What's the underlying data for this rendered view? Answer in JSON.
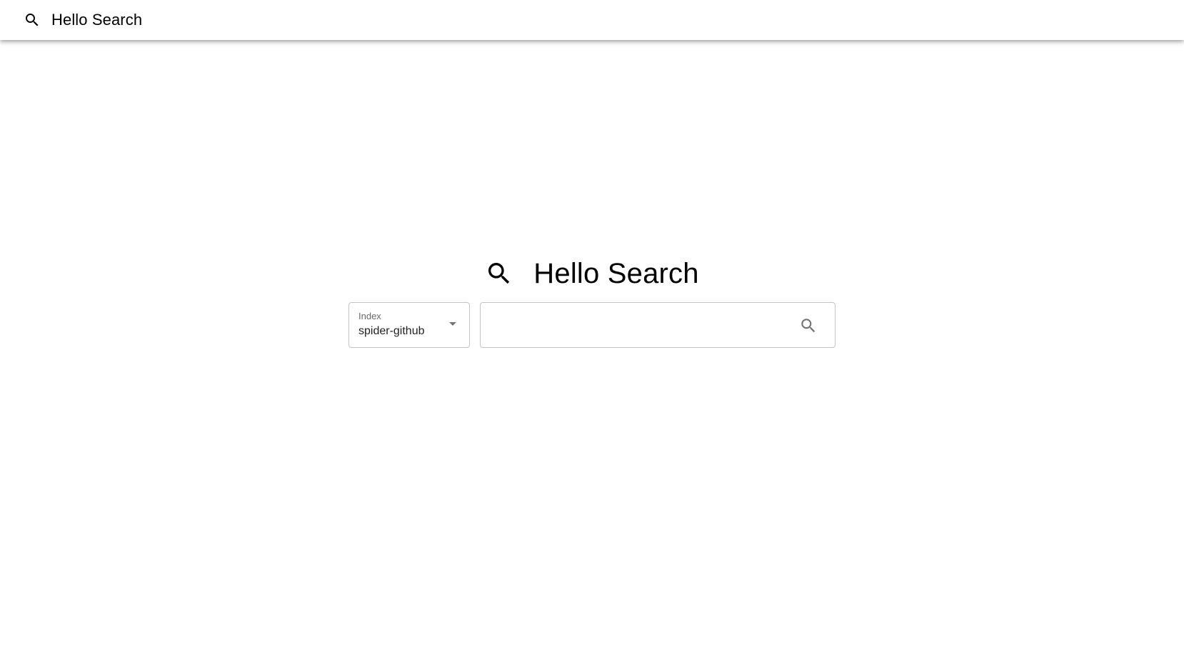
{
  "appbar": {
    "icon": "search-icon",
    "title": "Hello Search"
  },
  "hero": {
    "icon": "search-icon",
    "title": "Hello Search"
  },
  "index_select": {
    "label": "Index",
    "value": "spider-github",
    "icon": "dropdown-arrow-icon"
  },
  "search": {
    "value": "",
    "placeholder": "",
    "icon": "search-icon"
  },
  "colors": {
    "background": "#ffffff",
    "text": "#000000",
    "border": "#c4c4c4",
    "muted_icon": "#757575"
  }
}
